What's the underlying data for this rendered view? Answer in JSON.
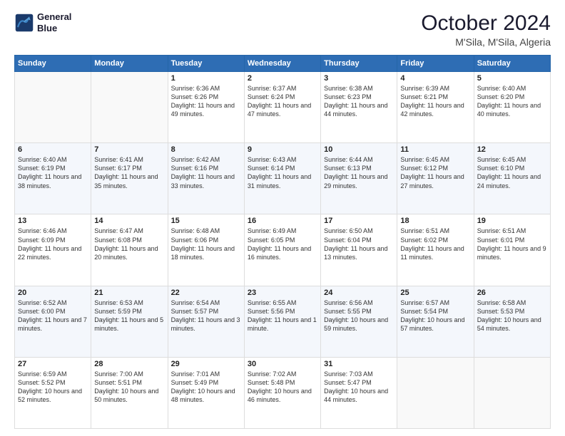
{
  "header": {
    "logo_line1": "General",
    "logo_line2": "Blue",
    "month_year": "October 2024",
    "location": "M'Sila, M'Sila, Algeria"
  },
  "days_of_week": [
    "Sunday",
    "Monday",
    "Tuesday",
    "Wednesday",
    "Thursday",
    "Friday",
    "Saturday"
  ],
  "weeks": [
    [
      {
        "day": "",
        "sunrise": "",
        "sunset": "",
        "daylight": ""
      },
      {
        "day": "",
        "sunrise": "",
        "sunset": "",
        "daylight": ""
      },
      {
        "day": "1",
        "sunrise": "Sunrise: 6:36 AM",
        "sunset": "Sunset: 6:26 PM",
        "daylight": "Daylight: 11 hours and 49 minutes."
      },
      {
        "day": "2",
        "sunrise": "Sunrise: 6:37 AM",
        "sunset": "Sunset: 6:24 PM",
        "daylight": "Daylight: 11 hours and 47 minutes."
      },
      {
        "day": "3",
        "sunrise": "Sunrise: 6:38 AM",
        "sunset": "Sunset: 6:23 PM",
        "daylight": "Daylight: 11 hours and 44 minutes."
      },
      {
        "day": "4",
        "sunrise": "Sunrise: 6:39 AM",
        "sunset": "Sunset: 6:21 PM",
        "daylight": "Daylight: 11 hours and 42 minutes."
      },
      {
        "day": "5",
        "sunrise": "Sunrise: 6:40 AM",
        "sunset": "Sunset: 6:20 PM",
        "daylight": "Daylight: 11 hours and 40 minutes."
      }
    ],
    [
      {
        "day": "6",
        "sunrise": "Sunrise: 6:40 AM",
        "sunset": "Sunset: 6:19 PM",
        "daylight": "Daylight: 11 hours and 38 minutes."
      },
      {
        "day": "7",
        "sunrise": "Sunrise: 6:41 AM",
        "sunset": "Sunset: 6:17 PM",
        "daylight": "Daylight: 11 hours and 35 minutes."
      },
      {
        "day": "8",
        "sunrise": "Sunrise: 6:42 AM",
        "sunset": "Sunset: 6:16 PM",
        "daylight": "Daylight: 11 hours and 33 minutes."
      },
      {
        "day": "9",
        "sunrise": "Sunrise: 6:43 AM",
        "sunset": "Sunset: 6:14 PM",
        "daylight": "Daylight: 11 hours and 31 minutes."
      },
      {
        "day": "10",
        "sunrise": "Sunrise: 6:44 AM",
        "sunset": "Sunset: 6:13 PM",
        "daylight": "Daylight: 11 hours and 29 minutes."
      },
      {
        "day": "11",
        "sunrise": "Sunrise: 6:45 AM",
        "sunset": "Sunset: 6:12 PM",
        "daylight": "Daylight: 11 hours and 27 minutes."
      },
      {
        "day": "12",
        "sunrise": "Sunrise: 6:45 AM",
        "sunset": "Sunset: 6:10 PM",
        "daylight": "Daylight: 11 hours and 24 minutes."
      }
    ],
    [
      {
        "day": "13",
        "sunrise": "Sunrise: 6:46 AM",
        "sunset": "Sunset: 6:09 PM",
        "daylight": "Daylight: 11 hours and 22 minutes."
      },
      {
        "day": "14",
        "sunrise": "Sunrise: 6:47 AM",
        "sunset": "Sunset: 6:08 PM",
        "daylight": "Daylight: 11 hours and 20 minutes."
      },
      {
        "day": "15",
        "sunrise": "Sunrise: 6:48 AM",
        "sunset": "Sunset: 6:06 PM",
        "daylight": "Daylight: 11 hours and 18 minutes."
      },
      {
        "day": "16",
        "sunrise": "Sunrise: 6:49 AM",
        "sunset": "Sunset: 6:05 PM",
        "daylight": "Daylight: 11 hours and 16 minutes."
      },
      {
        "day": "17",
        "sunrise": "Sunrise: 6:50 AM",
        "sunset": "Sunset: 6:04 PM",
        "daylight": "Daylight: 11 hours and 13 minutes."
      },
      {
        "day": "18",
        "sunrise": "Sunrise: 6:51 AM",
        "sunset": "Sunset: 6:02 PM",
        "daylight": "Daylight: 11 hours and 11 minutes."
      },
      {
        "day": "19",
        "sunrise": "Sunrise: 6:51 AM",
        "sunset": "Sunset: 6:01 PM",
        "daylight": "Daylight: 11 hours and 9 minutes."
      }
    ],
    [
      {
        "day": "20",
        "sunrise": "Sunrise: 6:52 AM",
        "sunset": "Sunset: 6:00 PM",
        "daylight": "Daylight: 11 hours and 7 minutes."
      },
      {
        "day": "21",
        "sunrise": "Sunrise: 6:53 AM",
        "sunset": "Sunset: 5:59 PM",
        "daylight": "Daylight: 11 hours and 5 minutes."
      },
      {
        "day": "22",
        "sunrise": "Sunrise: 6:54 AM",
        "sunset": "Sunset: 5:57 PM",
        "daylight": "Daylight: 11 hours and 3 minutes."
      },
      {
        "day": "23",
        "sunrise": "Sunrise: 6:55 AM",
        "sunset": "Sunset: 5:56 PM",
        "daylight": "Daylight: 11 hours and 1 minute."
      },
      {
        "day": "24",
        "sunrise": "Sunrise: 6:56 AM",
        "sunset": "Sunset: 5:55 PM",
        "daylight": "Daylight: 10 hours and 59 minutes."
      },
      {
        "day": "25",
        "sunrise": "Sunrise: 6:57 AM",
        "sunset": "Sunset: 5:54 PM",
        "daylight": "Daylight: 10 hours and 57 minutes."
      },
      {
        "day": "26",
        "sunrise": "Sunrise: 6:58 AM",
        "sunset": "Sunset: 5:53 PM",
        "daylight": "Daylight: 10 hours and 54 minutes."
      }
    ],
    [
      {
        "day": "27",
        "sunrise": "Sunrise: 6:59 AM",
        "sunset": "Sunset: 5:52 PM",
        "daylight": "Daylight: 10 hours and 52 minutes."
      },
      {
        "day": "28",
        "sunrise": "Sunrise: 7:00 AM",
        "sunset": "Sunset: 5:51 PM",
        "daylight": "Daylight: 10 hours and 50 minutes."
      },
      {
        "day": "29",
        "sunrise": "Sunrise: 7:01 AM",
        "sunset": "Sunset: 5:49 PM",
        "daylight": "Daylight: 10 hours and 48 minutes."
      },
      {
        "day": "30",
        "sunrise": "Sunrise: 7:02 AM",
        "sunset": "Sunset: 5:48 PM",
        "daylight": "Daylight: 10 hours and 46 minutes."
      },
      {
        "day": "31",
        "sunrise": "Sunrise: 7:03 AM",
        "sunset": "Sunset: 5:47 PM",
        "daylight": "Daylight: 10 hours and 44 minutes."
      },
      {
        "day": "",
        "sunrise": "",
        "sunset": "",
        "daylight": ""
      },
      {
        "day": "",
        "sunrise": "",
        "sunset": "",
        "daylight": ""
      }
    ]
  ]
}
